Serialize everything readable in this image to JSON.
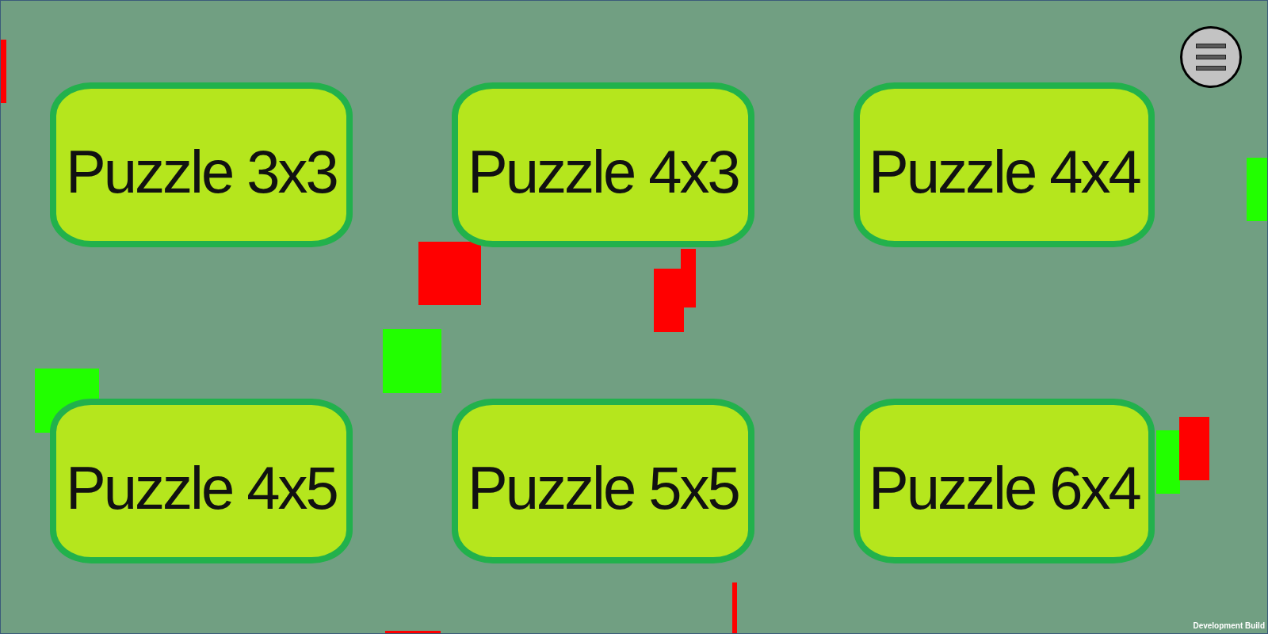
{
  "puzzles": [
    {
      "label": "Puzzle 3x3"
    },
    {
      "label": "Puzzle 4x3"
    },
    {
      "label": "Puzzle 4x4"
    },
    {
      "label": "Puzzle 4x5"
    },
    {
      "label": "Puzzle 5x5"
    },
    {
      "label": "Puzzle 6x4"
    }
  ],
  "blocks": [
    {
      "color": "#ff0000"
    },
    {
      "color": "#ff0000"
    },
    {
      "color": "#22ff00"
    },
    {
      "color": "#ff0000"
    },
    {
      "color": "#ff0000"
    },
    {
      "color": "#22ff00"
    },
    {
      "color": "#22ff00"
    },
    {
      "color": "#22ff00"
    },
    {
      "color": "#ff0000"
    },
    {
      "color": "#ff0000"
    },
    {
      "color": "#ff0000"
    }
  ],
  "build_label": "Development Build"
}
